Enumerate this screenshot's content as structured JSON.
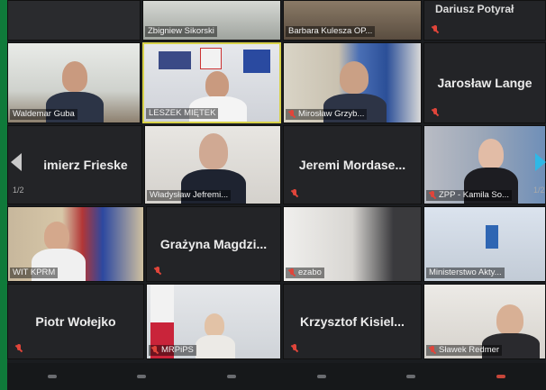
{
  "meeting": {
    "page_indicator_left": "1/2",
    "page_indicator_right": "1/2"
  },
  "participants": [
    {
      "name": "Zbigniew Sikorski"
    },
    {
      "name": "Barbara Kulesza OP..."
    },
    {
      "name": "Dariusz Potyrał"
    },
    {
      "name": "Waldemar Guba"
    },
    {
      "name": "LESZEK MIĘTEK"
    },
    {
      "name": "Mirosław Grzyb..."
    },
    {
      "name": "Jarosław Lange"
    },
    {
      "name": "imierz Frieske"
    },
    {
      "name": "Władysław Jefremi..."
    },
    {
      "name": "Jeremi Mordase..."
    },
    {
      "name": "ZPP - Kamila So..."
    },
    {
      "name": "WIT KPRM"
    },
    {
      "name": "Grażyna Magdzi..."
    },
    {
      "name": "ezabo"
    },
    {
      "name": "Ministerstwo Akty..."
    },
    {
      "name": "Piotr Wołejko"
    },
    {
      "name": "MRPiPS"
    },
    {
      "name": "Krzysztof Kisiel..."
    },
    {
      "name": "Sławek Redmer"
    }
  ],
  "colors": {
    "accent": "#0f7a3a",
    "active_speaker_border": "#d8d24a",
    "muted_mic": "#e0453a",
    "tile_bg": "#232427"
  },
  "icons": [
    "muted-mic-icon",
    "chevron-left-icon",
    "chevron-right-icon"
  ]
}
